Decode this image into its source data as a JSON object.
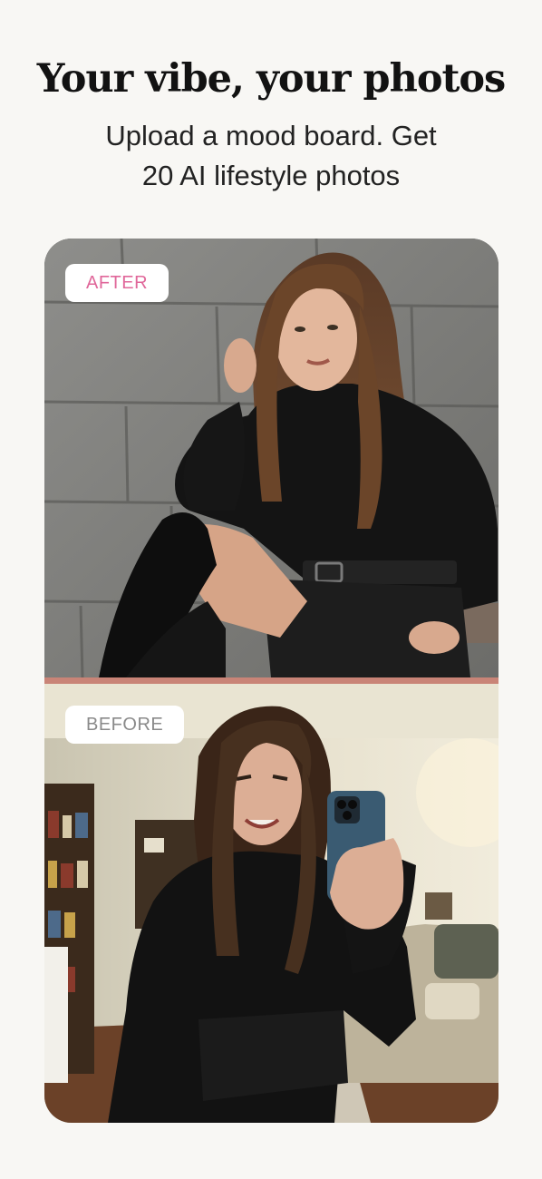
{
  "header": {
    "title": "Your vibe, your photos",
    "subtitle_line1": "Upload a mood board. Get",
    "subtitle_line2": "20 AI lifestyle photos"
  },
  "comparison": {
    "after_label": "AFTER",
    "before_label": "BEFORE"
  },
  "colors": {
    "background": "#f8f7f4",
    "divider": "#c98477",
    "after_label": "#e0679a",
    "before_label": "#8a8a8a"
  }
}
